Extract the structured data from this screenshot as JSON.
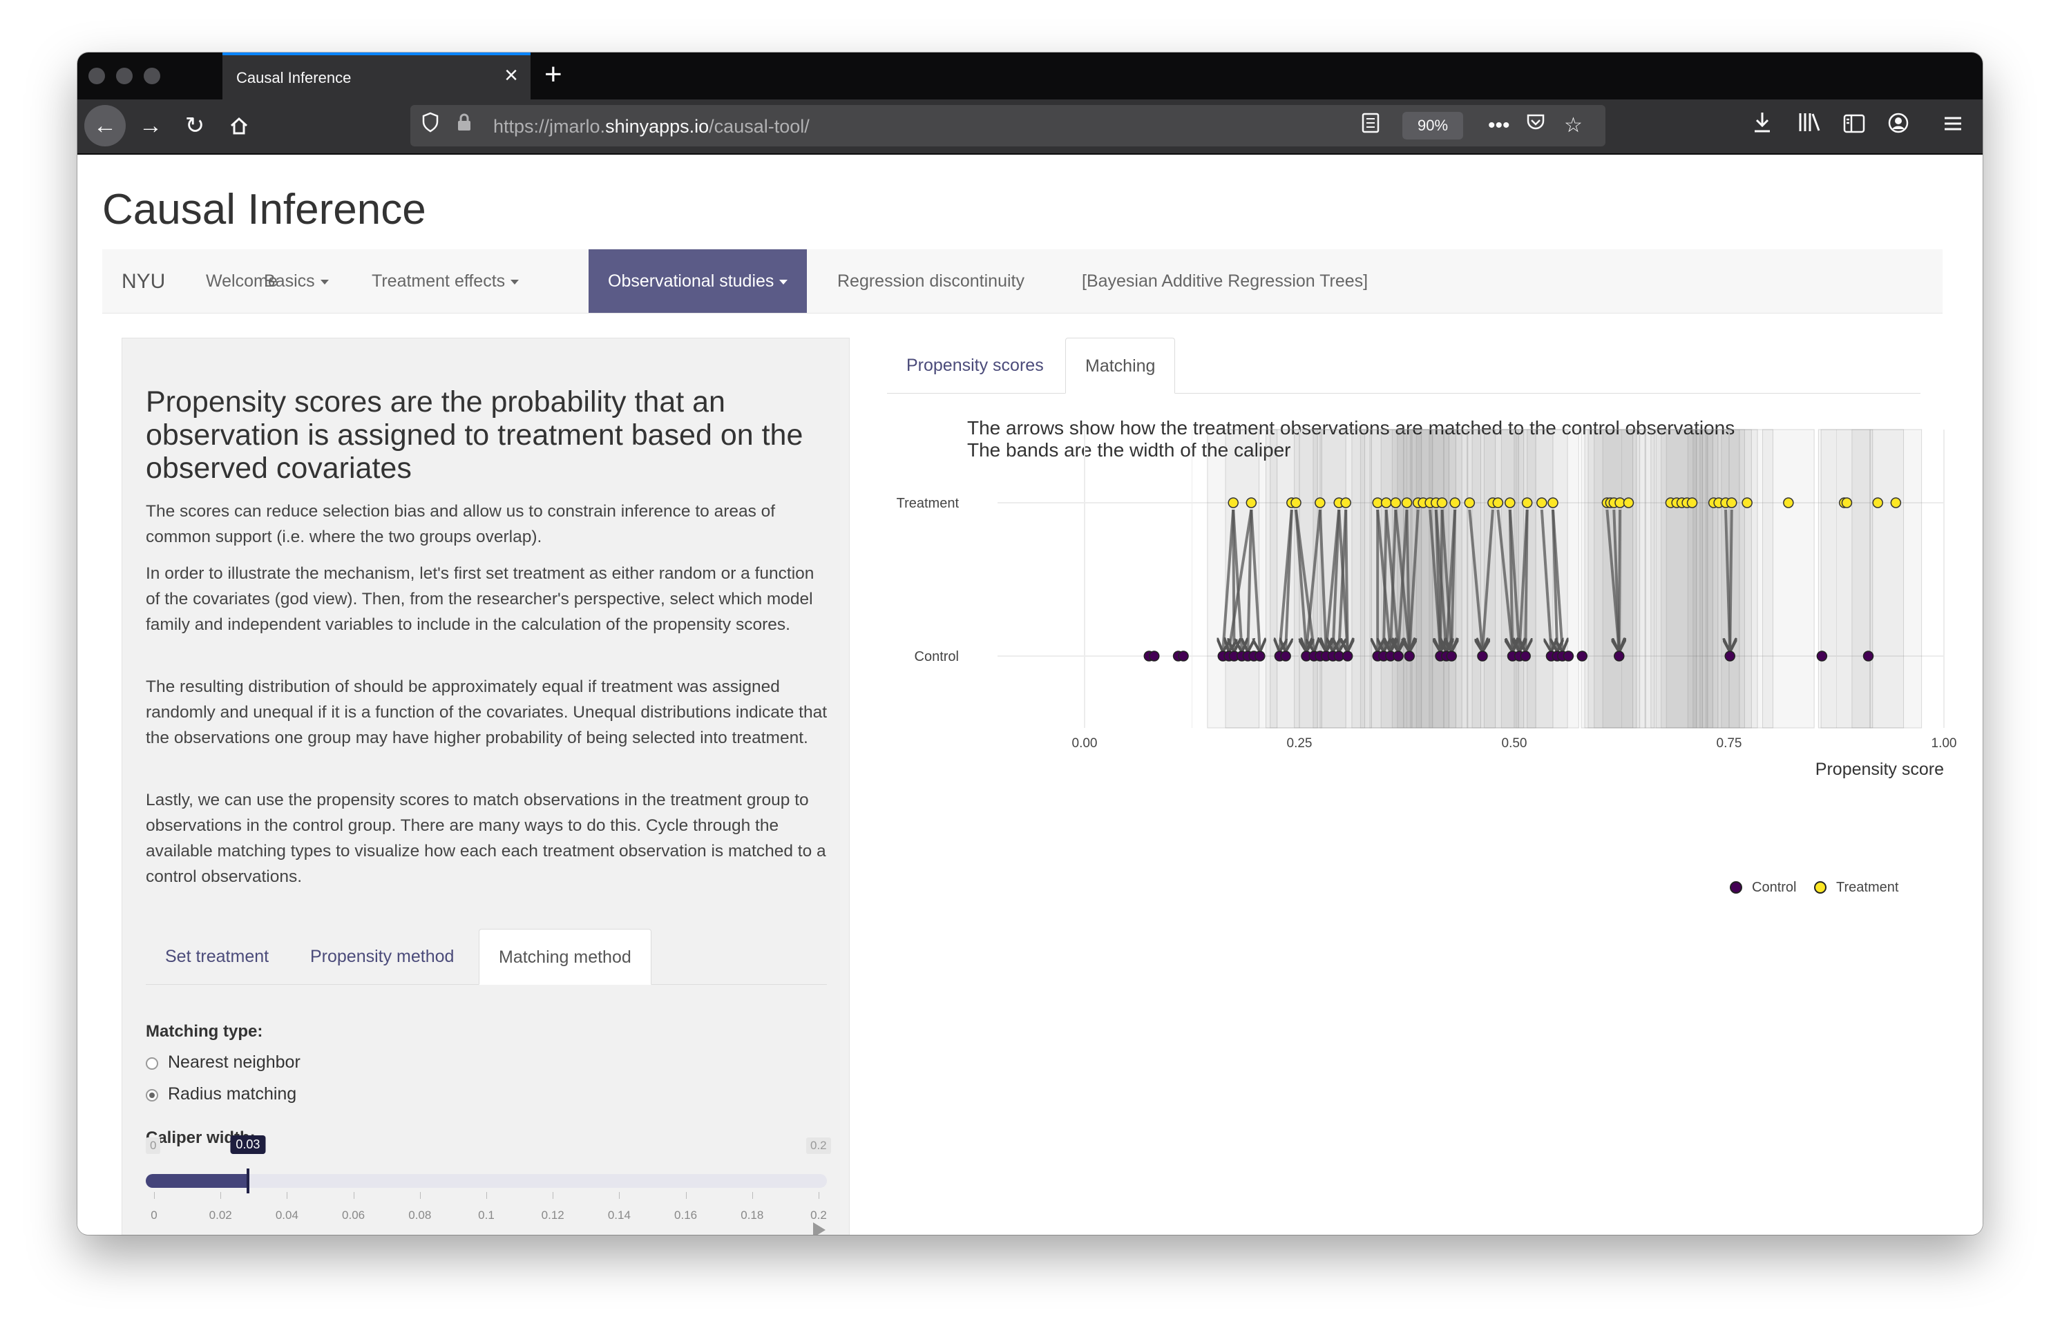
{
  "browser": {
    "tab_title": "Causal Inference",
    "url_prefix": "https://jmarlo.",
    "url_domain": "shinyapps.io",
    "url_path": "/causal-tool/",
    "zoom": "90%"
  },
  "app": {
    "title": "Causal Inference",
    "brand": "NYU",
    "nav": [
      {
        "label": "Welcome"
      },
      {
        "label": "Basics"
      },
      {
        "label": "Treatment effects"
      },
      {
        "label": "Observational studies"
      },
      {
        "label": "Regression discontinuity"
      },
      {
        "label": "[Bayesian Additive Regression Trees]"
      }
    ],
    "nav_active": "Observational studies"
  },
  "sidebar": {
    "heading": "Propensity scores are the probability that an observation is assigned to treatment based on the observed covariates",
    "paragraphs": [
      "The scores can reduce selection bias and allow us to constrain inference to areas of common support (i.e. where the two groups overlap).",
      "In order to illustrate the mechanism, let's first set treatment as either random or a function of the covariates (god view). Then, from the researcher's perspective, select which model family and independent variables to include in the calculation of the propensity scores.",
      "The resulting distribution of should be approximately equal if treatment was assigned randomly and unequal if it is a function of the covariates. Unequal distributions indicate that the observations one group may have higher probability of being selected into treatment.",
      "Lastly, we can use the propensity scores to match observations in the treatment group to observations in the control group. There are many ways to do this. Cycle through the available matching types to visualize how each each treatment observation is matched to a control observations."
    ],
    "tabs": [
      "Set treatment",
      "Propensity method",
      "Matching method"
    ],
    "active_tab": "Matching method",
    "matching_type_label": "Matching type:",
    "matching_options": [
      "Nearest neighbor",
      "Radius matching"
    ],
    "matching_selected": "Radius matching",
    "caliper_label": "Caliper width:",
    "caliper": {
      "min": "0",
      "max": "0.2",
      "value": 0.03,
      "value_label": "0.03",
      "ticks": [
        "0",
        "0.02",
        "0.04",
        "0.06",
        "0.08",
        "0.1",
        "0.12",
        "0.14",
        "0.16",
        "0.18",
        "0.2"
      ]
    }
  },
  "main": {
    "tabs": [
      "Propensity scores",
      "Matching"
    ],
    "active_tab": "Matching",
    "plot_title_line1": "The arrows show how the treatment observations are matched to the control observations",
    "plot_title_line2": "The bands are the width of the caliper"
  },
  "chart_data": {
    "type": "scatter",
    "title": "The arrows show how the treatment observations are matched to the control observations\nThe bands are the width of the caliper",
    "xlabel": "Propensity score",
    "ylabel": "",
    "xlim": [
      0,
      1.05
    ],
    "x_ticks": [
      "0.00",
      "0.25",
      "0.50",
      "0.75",
      "1.00"
    ],
    "y_categories": [
      "Control",
      "Treatment"
    ],
    "legend": [
      {
        "name": "Control",
        "color": "#440154"
      },
      {
        "name": "Treatment",
        "color": "#fde725"
      }
    ],
    "legend_position": "bottom-right",
    "caliper": 0.03,
    "series": [
      {
        "name": "Treatment",
        "values": [
          0.173,
          0.194,
          0.241,
          0.246,
          0.274,
          0.296,
          0.304,
          0.341,
          0.351,
          0.362,
          0.375,
          0.388,
          0.394,
          0.402,
          0.409,
          0.416,
          0.431,
          0.448,
          0.475,
          0.481,
          0.495,
          0.515,
          0.532,
          0.545,
          0.608,
          0.612,
          0.616,
          0.623,
          0.633,
          0.682,
          0.689,
          0.695,
          0.701,
          0.707,
          0.732,
          0.738,
          0.746,
          0.753,
          0.771,
          0.819,
          0.884,
          0.887,
          0.923,
          0.944
        ]
      },
      {
        "name": "Control",
        "values": [
          0.075,
          0.081,
          0.109,
          0.115,
          0.161,
          0.168,
          0.174,
          0.183,
          0.19,
          0.197,
          0.204,
          0.227,
          0.234,
          0.258,
          0.267,
          0.274,
          0.281,
          0.289,
          0.296,
          0.306,
          0.341,
          0.348,
          0.356,
          0.365,
          0.378,
          0.414,
          0.421,
          0.427,
          0.463,
          0.498,
          0.506,
          0.513,
          0.543,
          0.55,
          0.556,
          0.563,
          0.579,
          0.622,
          0.751,
          0.858,
          0.912
        ]
      }
    ],
    "matches": [
      [
        0.173,
        0.161
      ],
      [
        0.173,
        0.174
      ],
      [
        0.173,
        0.183
      ],
      [
        0.194,
        0.168
      ],
      [
        0.194,
        0.19
      ],
      [
        0.194,
        0.204
      ],
      [
        0.241,
        0.227
      ],
      [
        0.241,
        0.234
      ],
      [
        0.246,
        0.258
      ],
      [
        0.246,
        0.267
      ],
      [
        0.274,
        0.258
      ],
      [
        0.274,
        0.281
      ],
      [
        0.296,
        0.281
      ],
      [
        0.296,
        0.289
      ],
      [
        0.296,
        0.306
      ],
      [
        0.304,
        0.296
      ],
      [
        0.304,
        0.306
      ],
      [
        0.341,
        0.341
      ],
      [
        0.341,
        0.356
      ],
      [
        0.351,
        0.348
      ],
      [
        0.351,
        0.365
      ],
      [
        0.362,
        0.356
      ],
      [
        0.362,
        0.378
      ],
      [
        0.375,
        0.365
      ],
      [
        0.375,
        0.378
      ],
      [
        0.388,
        0.378
      ],
      [
        0.402,
        0.414
      ],
      [
        0.409,
        0.414
      ],
      [
        0.409,
        0.421
      ],
      [
        0.416,
        0.414
      ],
      [
        0.416,
        0.427
      ],
      [
        0.431,
        0.427
      ],
      [
        0.431,
        0.421
      ],
      [
        0.448,
        0.463
      ],
      [
        0.475,
        0.463
      ],
      [
        0.481,
        0.498
      ],
      [
        0.495,
        0.498
      ],
      [
        0.495,
        0.506
      ],
      [
        0.515,
        0.506
      ],
      [
        0.515,
        0.513
      ],
      [
        0.532,
        0.543
      ],
      [
        0.545,
        0.55
      ],
      [
        0.545,
        0.556
      ],
      [
        0.608,
        0.622
      ],
      [
        0.616,
        0.622
      ],
      [
        0.623,
        0.622
      ],
      [
        0.746,
        0.751
      ],
      [
        0.753,
        0.751
      ]
    ]
  }
}
